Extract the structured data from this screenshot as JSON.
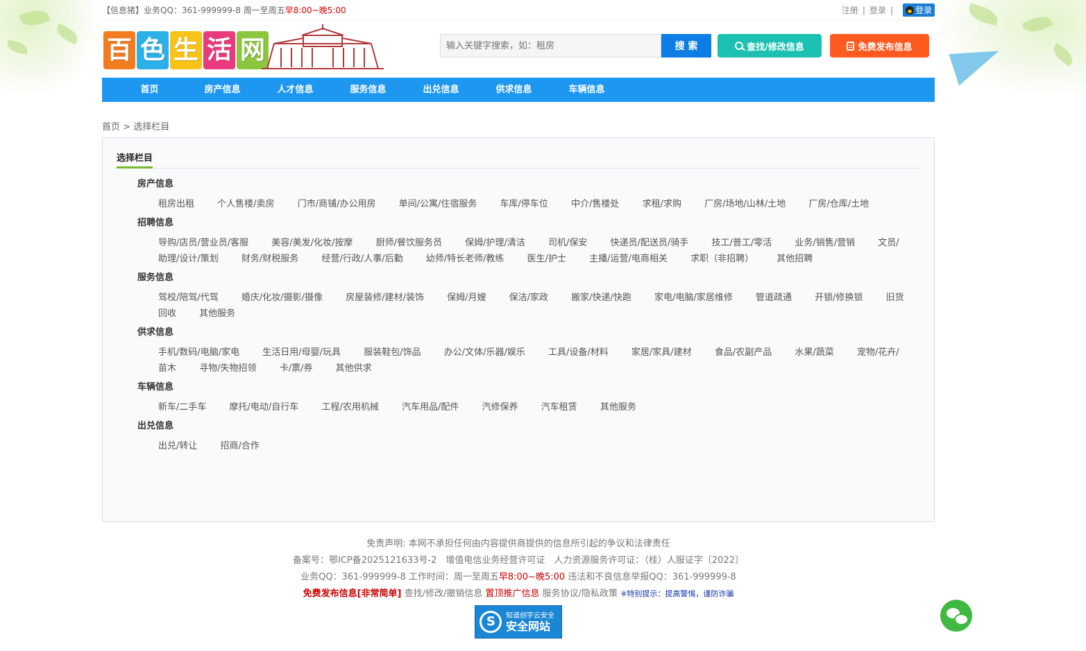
{
  "topbar": {
    "info_prefix": "【信息猪】业务QQ：361-999999-8 周一至周五",
    "info_hours": "早8:00~晚5:00",
    "register": "注册",
    "login": "登录",
    "qq_login": "登录",
    "sep": "|"
  },
  "header": {
    "logo_chars": [
      "百",
      "色",
      "生",
      "活",
      "网"
    ],
    "logo_colors": [
      "#f47c20",
      "#2bb0e8",
      "#f7c319",
      "#e93a7d",
      "#8cc63e"
    ],
    "search_placeholder": "输入关键字搜索，如：租房",
    "search_button": "搜 索",
    "find_button": "查找/修改信息",
    "post_button": "免费发布信息"
  },
  "nav": [
    "首页",
    "房产信息",
    "人才信息",
    "服务信息",
    "出兑信息",
    "供求信息",
    "车辆信息"
  ],
  "breadcrumb": {
    "home": "首页",
    "sep": ">",
    "current": "选择栏目"
  },
  "panel_title": "选择栏目",
  "categories": [
    {
      "title": "房产信息",
      "items": [
        "租房出租",
        "个人售楼/卖房",
        "门市/商铺/办公用房",
        "单间/公寓/住宿服务",
        "车库/停车位",
        "中介/售楼处",
        "求租/求购",
        "厂房/场地/山林/土地",
        "厂房/仓库/土地"
      ]
    },
    {
      "title": "招聘信息",
      "items": [
        "导购/店员/营业员/客服",
        "美容/美发/化妆/按摩",
        "厨师/餐饮服务员",
        "保姆/护理/清洁",
        "司机/保安",
        "快递员/配送员/骑手",
        "技工/普工/零活",
        "业务/销售/营销",
        "文员/助理/设计/策划",
        "财务/财税服务",
        "经营/行政/人事/后勤",
        "幼师/特长老师/教练",
        "医生/护士",
        "主播/运营/电商相关",
        "求职（非招聘）",
        "其他招聘"
      ]
    },
    {
      "title": "服务信息",
      "items": [
        "驾校/陪驾/代驾",
        "婚庆/化妆/摄影/摄像",
        "房屋装修/建材/装饰",
        "保姆/月嫂",
        "保洁/家政",
        "搬家/快递/快跑",
        "家电/电脑/家居维修",
        "管道疏通",
        "开锁/修换锁",
        "旧货回收",
        "其他服务"
      ]
    },
    {
      "title": "供求信息",
      "items": [
        "手机/数码/电脑/家电",
        "生活日用/母婴/玩具",
        "服装鞋包/饰品",
        "办公/文体/乐器/娱乐",
        "工具/设备/材料",
        "家居/家具/建材",
        "食品/农副产品",
        "水果/蔬菜",
        "宠物/花卉/苗木",
        "寻物/失物招领",
        "卡/票/券",
        "其他供求"
      ]
    },
    {
      "title": "车辆信息",
      "items": [
        "新车/二手车",
        "摩托/电动/自行车",
        "工程/农用机械",
        "汽车用品/配件",
        "汽修保养",
        "汽车租赁",
        "其他服务"
      ]
    },
    {
      "title": "出兑信息",
      "items": [
        "出兑/转让",
        "招商/合作"
      ]
    }
  ],
  "footer": {
    "disclaimer": "免责声明: 本网不承担任何由内容提供商提供的信息所引起的争议和法律责任",
    "license": "备案号：鄂ICP备2025121633号-2　增值电信业务经营许可证　人力资源服务许可证：（桂）人服证字〔2022〕",
    "contact_prefix": "业务QQ：361-999999-8 工作时间：周一至周五",
    "contact_hours": "早8:00~晚5:00",
    "contact_suffix": " 违法和不良信息举报QQ：361-999999-8",
    "free_post": "免费发布信息[非常简单]",
    "manage": " 查找/修改/撤销信息 ",
    "promote": "置顶推广信息",
    "agreement": " 服务协议/隐私政策 ",
    "warning": "※特别提示：提高警惕，谨防诈骗",
    "badge_line1": "知道创宇云安全",
    "badge_line2": "安全网站"
  }
}
